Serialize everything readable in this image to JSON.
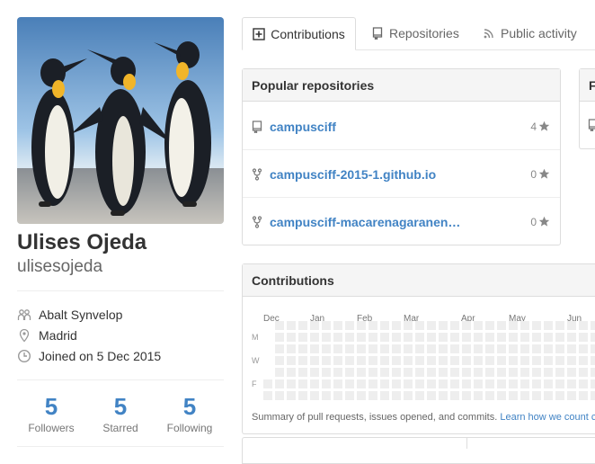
{
  "profile": {
    "fullname": "Ulises Ojeda",
    "username": "ulisesojeda",
    "avatar_icon": "penguins-photo",
    "details": [
      {
        "icon": "organization-icon",
        "text": "Abalt Synvelop"
      },
      {
        "icon": "location-icon",
        "text": "Madrid"
      },
      {
        "icon": "clock-icon",
        "text": "Joined on 5 Dec 2015"
      }
    ],
    "stats": [
      {
        "count": "5",
        "label": "Followers"
      },
      {
        "count": "5",
        "label": "Starred"
      },
      {
        "count": "5",
        "label": "Following"
      }
    ]
  },
  "tabs": [
    {
      "label": "Contributions",
      "icon": "diff-added-icon",
      "selected": true
    },
    {
      "label": "Repositories",
      "icon": "repo-icon",
      "selected": false
    },
    {
      "label": "Public activity",
      "icon": "rss-icon",
      "selected": false
    }
  ],
  "popular_repos": {
    "title": "Popular repositories",
    "items": [
      {
        "name": "campusciff",
        "icon": "repo-icon",
        "stars": "4"
      },
      {
        "name": "campusciff-2015-1.github.io",
        "icon": "repo-forked-icon",
        "stars": "0"
      },
      {
        "name": "campusciff-macarenagaranen…",
        "icon": "repo-forked-icon",
        "stars": "0"
      }
    ]
  },
  "side_box": {
    "title_fragment": "F"
  },
  "contributions": {
    "title": "Contributions",
    "months": [
      "Dec",
      "Jan",
      "Feb",
      "Mar",
      "Apr",
      "May",
      "Jun"
    ],
    "days": [
      "M",
      "W",
      "F"
    ],
    "summary_text": "Summary of pull requests, issues opened, and commits.",
    "summary_link": "Learn how we count c"
  },
  "colors": {
    "link": "#4183c4",
    "cell_empty": "#eeeeee",
    "header_bg": "#f5f5f5"
  }
}
